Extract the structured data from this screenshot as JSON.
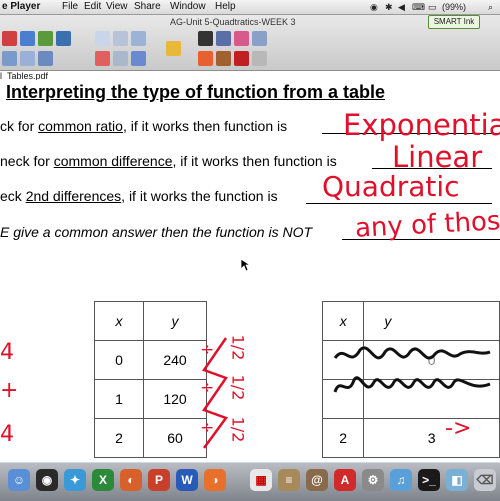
{
  "menubar": {
    "app_name": "e Player",
    "items": [
      "File",
      "Edit",
      "View",
      "Share",
      "Window",
      "Help"
    ],
    "battery": "(99%)"
  },
  "window": {
    "title": "AG-Unit 5-Quadtratics-WEEK 3",
    "smart_ink": "SMART Ink"
  },
  "document": {
    "filename": "l_Tables.pdf",
    "heading": "Interpreting the type of function from a table",
    "rules": [
      {
        "prefix": "ck for ",
        "key": "common ratio",
        "suffix": ", if it works then function is",
        "answer": "Exponentia"
      },
      {
        "prefix": "neck for ",
        "key": "common difference",
        "suffix": ", if it works then function is",
        "answer": "Linear"
      },
      {
        "prefix": "eck ",
        "key": "2nd differences",
        "suffix": ", if it works the function is",
        "answer": "Quadratic"
      },
      {
        "prefix": "E give a common answer then the function is NOT",
        "key": "",
        "suffix": "",
        "answer": "any of thos"
      }
    ],
    "table_left": {
      "headers": [
        "x",
        "y"
      ],
      "rows": [
        [
          "0",
          "240"
        ],
        [
          "1",
          "120"
        ],
        [
          "2",
          "60"
        ]
      ],
      "annotation_ops": [
        "÷",
        "÷",
        "÷"
      ],
      "annotation_fraction": "1/2"
    },
    "table_right": {
      "headers": [
        "x",
        "y"
      ],
      "rows": [
        [
          "",
          "0"
        ],
        [
          "",
          ""
        ],
        [
          "2",
          "3"
        ]
      ],
      "annotation": "->"
    }
  },
  "dock": {
    "icons": [
      "finder-icon",
      "dashboard-icon",
      "safari-icon",
      "excel-icon",
      "firefox-icon",
      "powerpoint-icon",
      "word-icon",
      "calendar-icon",
      "notes-icon",
      "acrobat-icon",
      "system-preferences-icon",
      "itunes-icon",
      "terminal-icon",
      "preview-icon",
      "trash-icon"
    ]
  },
  "colors": {
    "ink_red": "#e0102a",
    "menubar_bg": "#e5e5e5",
    "dock_bg": "#9ea2a8"
  }
}
